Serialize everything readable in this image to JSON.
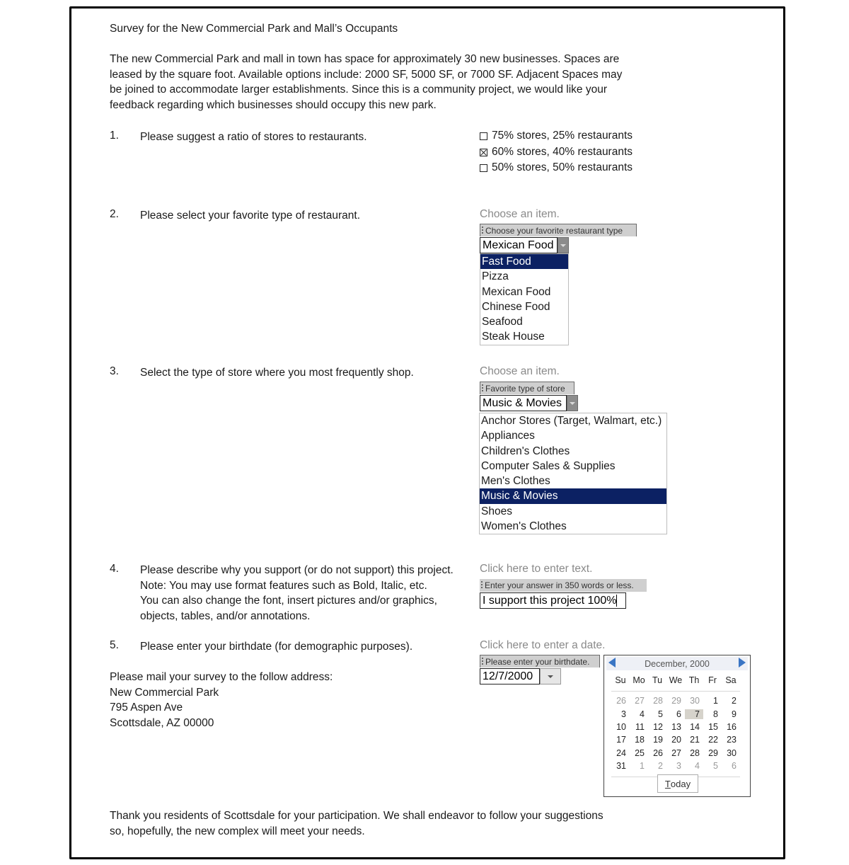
{
  "document": {
    "title": "Survey for the New Commercial Park and Mall’s Occupants",
    "intro_lines": [
      "The new Commercial Park and mall in town has space for approximately 30 new businesses. Spaces are",
      "leased by the square foot. Available options include: 2000 SF, 5000 SF, or 7000 SF. Adjacent Spaces may",
      "be joined to accommodate larger establishments. Since this is a community project, we would like your",
      "feedback regarding which businesses should occupy this new park."
    ]
  },
  "questions": {
    "q1": {
      "number": "1.",
      "text": "Please suggest a ratio of stores to restaurants.",
      "options": [
        {
          "label": "75% stores, 25% restaurants",
          "checked": false
        },
        {
          "label": "60% stores, 40% restaurants",
          "checked": true
        },
        {
          "label": "50% stores, 50% restaurants",
          "checked": false
        }
      ]
    },
    "q2": {
      "number": "2.",
      "text": "Please select your favorite type of restaurant.",
      "placeholder": "Choose an item.",
      "control_title": "Choose your favorite restaurant type",
      "value": "Mexican Food",
      "options": [
        "Fast Food",
        "Pizza",
        "Mexican Food",
        "Chinese Food",
        "Seafood",
        "Steak House"
      ],
      "highlighted": "Fast Food"
    },
    "q3": {
      "number": "3.",
      "text": "Select the type of store where you most frequently shop.",
      "placeholder": "Choose an item.",
      "control_title": "Favorite type of store",
      "value": "Music & Movies",
      "options": [
        "Anchor Stores (Target, Walmart, etc.)",
        "Appliances",
        "Children's Clothes",
        "Computer Sales & Supplies",
        "Men's Clothes",
        "Music & Movies",
        "Shoes",
        "Women's Clothes"
      ],
      "highlighted": "Music & Movies"
    },
    "q4": {
      "number": "4.",
      "text_lines": [
        "Please describe why you support (or do not support) this project.",
        "Note: You may use format features such as Bold, Italic, etc.",
        "You can also change the font, insert pictures and/or graphics,",
        "objects, tables, and/or annotations."
      ],
      "placeholder": "Click here to enter text.",
      "control_title": "Enter your answer in 350 words or less.",
      "value": "I support this project 100%"
    },
    "q5": {
      "number": "5.",
      "text": "Please enter your birthdate (for demographic purposes).",
      "placeholder": "Click here to enter a date.",
      "control_title": "Please enter your birthdate.",
      "value": "12/7/2000"
    }
  },
  "calendar": {
    "month_label": "December, 2000",
    "weekdays": [
      "Su",
      "Mo",
      "Tu",
      "We",
      "Th",
      "Fr",
      "Sa"
    ],
    "weeks": [
      [
        {
          "d": "26",
          "o": true
        },
        {
          "d": "27",
          "o": true
        },
        {
          "d": "28",
          "o": true
        },
        {
          "d": "29",
          "o": true
        },
        {
          "d": "30",
          "o": true
        },
        {
          "d": "1"
        },
        {
          "d": "2"
        }
      ],
      [
        {
          "d": "3"
        },
        {
          "d": "4"
        },
        {
          "d": "5"
        },
        {
          "d": "6"
        },
        {
          "d": "7",
          "sel": true
        },
        {
          "d": "8"
        },
        {
          "d": "9"
        }
      ],
      [
        {
          "d": "10"
        },
        {
          "d": "11"
        },
        {
          "d": "12"
        },
        {
          "d": "13"
        },
        {
          "d": "14"
        },
        {
          "d": "15"
        },
        {
          "d": "16"
        }
      ],
      [
        {
          "d": "17"
        },
        {
          "d": "18"
        },
        {
          "d": "19"
        },
        {
          "d": "20"
        },
        {
          "d": "21"
        },
        {
          "d": "22"
        },
        {
          "d": "23"
        }
      ],
      [
        {
          "d": "24"
        },
        {
          "d": "25"
        },
        {
          "d": "26"
        },
        {
          "d": "27"
        },
        {
          "d": "28"
        },
        {
          "d": "29"
        },
        {
          "d": "30"
        }
      ],
      [
        {
          "d": "31"
        },
        {
          "d": "1",
          "o": true
        },
        {
          "d": "2",
          "o": true
        },
        {
          "d": "3",
          "o": true
        },
        {
          "d": "4",
          "o": true
        },
        {
          "d": "5",
          "o": true
        },
        {
          "d": "6",
          "o": true
        }
      ]
    ],
    "selected_day": "7",
    "today_label": "Today",
    "today_accel": "T"
  },
  "mailing": {
    "intro": "Please mail your survey to the follow address:",
    "lines": [
      "New Commercial Park",
      "795 Aspen Ave",
      "Scottsdale, AZ 00000"
    ]
  },
  "closing_lines": [
    "Thank you residents of Scottsdale for your participation. We shall endeavor to follow your suggestions",
    "so, hopefully, the new complex will meet your needs."
  ],
  "colors": {
    "highlight": "#0c2163",
    "nav_arrow": "#3a75c4",
    "placeholder_text": "#8a8a8a"
  }
}
